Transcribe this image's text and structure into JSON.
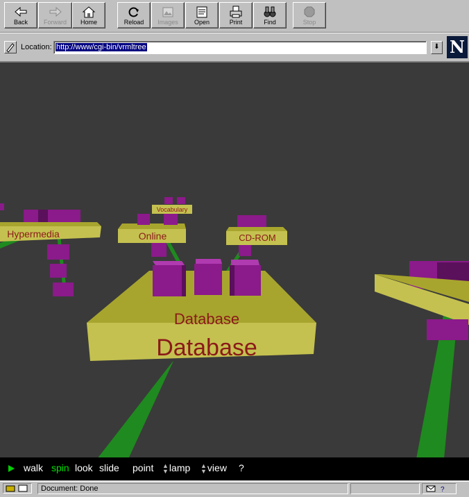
{
  "toolbar": {
    "buttons": [
      {
        "label": "Back",
        "icon": "back-arrow-icon",
        "enabled": true
      },
      {
        "label": "Forward",
        "icon": "forward-arrow-icon",
        "enabled": false
      },
      {
        "label": "Home",
        "icon": "home-icon",
        "enabled": true
      },
      {
        "label": "Reload",
        "icon": "reload-icon",
        "enabled": true
      },
      {
        "label": "Images",
        "icon": "images-icon",
        "enabled": false
      },
      {
        "label": "Open",
        "icon": "open-icon",
        "enabled": true
      },
      {
        "label": "Print",
        "icon": "printer-icon",
        "enabled": true
      },
      {
        "label": "Find",
        "icon": "binoculars-icon",
        "enabled": true
      },
      {
        "label": "Stop",
        "icon": "stop-icon",
        "enabled": false
      }
    ]
  },
  "location": {
    "label": "Location:",
    "url": "http://www/cgi-bin/vrmltree"
  },
  "logo": "N",
  "scene": {
    "nodes": {
      "database_top": "Database",
      "database_front": "Database",
      "online": "Online",
      "cdrom": "CD-ROM",
      "hypermedia": "Hypermedia",
      "vocabulary": "Vocabulary"
    },
    "colors": {
      "background": "#3a3a3a",
      "platform": "#b5b13a",
      "box": "#8b1a8b",
      "stem": "#1f8a1f",
      "label_text": "#8b1a1a"
    }
  },
  "navbar": {
    "play_icon": "play-icon",
    "modes": [
      "walk",
      "spin",
      "look",
      "slide"
    ],
    "active_mode": "spin",
    "tools": [
      "point",
      "lamp",
      "view",
      "?"
    ]
  },
  "status": {
    "text": "Document: Done"
  }
}
